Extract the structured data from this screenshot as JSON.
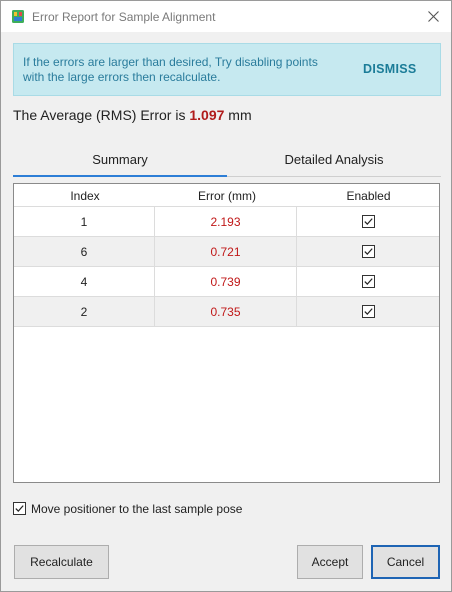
{
  "window": {
    "title": "Error Report for Sample Alignment"
  },
  "banner": {
    "line1": "If the errors are larger than desired, Try disabling points",
    "line2": "with the large errors then recalculate.",
    "dismiss_label": "DISMISS"
  },
  "rms": {
    "prefix": "The Average (RMS) Error is ",
    "value": "1.097",
    "unit": " mm"
  },
  "tabs": [
    {
      "label": "Summary",
      "active": true
    },
    {
      "label": "Detailed Analysis",
      "active": false
    }
  ],
  "table": {
    "headers": [
      "Index",
      "Error (mm)",
      "Enabled"
    ],
    "rows": [
      {
        "index": "1",
        "error": "2.193",
        "enabled": true
      },
      {
        "index": "6",
        "error": "0.721",
        "enabled": true
      },
      {
        "index": "4",
        "error": "0.739",
        "enabled": true
      },
      {
        "index": "2",
        "error": "0.735",
        "enabled": true
      }
    ]
  },
  "move_positioner": {
    "label": "Move positioner to the last sample pose",
    "checked": true
  },
  "buttons": {
    "recalculate": "Recalculate",
    "accept": "Accept",
    "cancel": "Cancel"
  },
  "colors": {
    "error_value": "#c01818",
    "rms_value": "#b01b1b",
    "banner_bg": "#c6e9f0",
    "tab_accent": "#2d7ed6"
  }
}
